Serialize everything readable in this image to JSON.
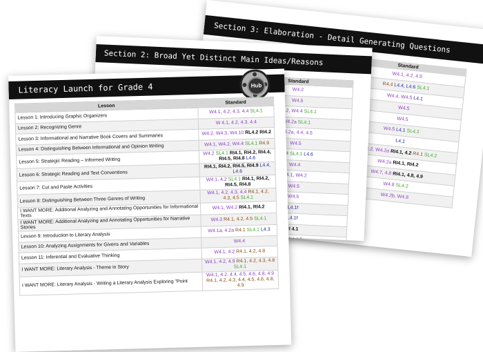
{
  "section3": {
    "title": "Section 3: Elaboration - Detail Generating Questions",
    "header": "Standard",
    "rows": [
      [
        {
          "t": "W4.1, 4.2, 4.5",
          "c": "purple"
        }
      ],
      [
        {
          "t": "R4.4",
          "c": "brown"
        },
        {
          "t": "L4.4, L4.6",
          "c": "navy"
        },
        {
          "t": "SL4.1",
          "c": "green"
        }
      ],
      [
        {
          "t": "W4.4, W4.5",
          "c": "purple"
        },
        {
          "t": "L4.1",
          "c": "navy"
        }
      ],
      [
        {
          "t": "W4.5",
          "c": "purple"
        }
      ],
      [
        {
          "t": "W4.5",
          "c": "purple"
        }
      ],
      [
        {
          "t": "W4.5",
          "c": "purple"
        },
        {
          "t": "L4.1",
          "c": "navy"
        },
        {
          "t": "SL4.1",
          "c": "green"
        }
      ],
      [
        {
          "t": "L4.1",
          "c": "navy"
        }
      ],
      [
        {
          "t": "W4.2, W4.2a",
          "c": "purple"
        },
        {
          "t": "RI4.1, 4.2",
          "c": "black"
        },
        {
          "t": "R4.1",
          "c": "brown"
        },
        {
          "t": "SL4.2",
          "c": "green"
        }
      ],
      [
        {
          "t": "W4.2a",
          "c": "purple"
        },
        {
          "t": "RI4.1, RI4.2",
          "c": "black"
        }
      ],
      [
        {
          "t": "W4.7, 4.8",
          "c": "purple"
        },
        {
          "t": "RI4.1, 4.8, 4.9",
          "c": "black"
        }
      ],
      [
        {
          "t": "W4.8",
          "c": "purple"
        },
        {
          "t": "SL4.2",
          "c": "green"
        }
      ],
      [
        {
          "t": "W4.2b, W4.8",
          "c": "purple"
        }
      ]
    ],
    "side_fragment": "ks"
  },
  "section2": {
    "title": "Section 2: Broad Yet Distinct Main Ideas/Reasons",
    "header": "Standard",
    "rows": [
      [
        {
          "t": "W4.2",
          "c": "purple"
        }
      ],
      [
        {
          "t": "W4.5",
          "c": "purple"
        }
      ],
      [
        {
          "t": "W4.2, W4.4",
          "c": "purple"
        },
        {
          "t": "SL4.1",
          "c": "green"
        }
      ],
      [
        {
          "t": "W4.2a",
          "c": "purple"
        },
        {
          "t": "SL4.1",
          "c": "green"
        }
      ],
      [
        {
          "t": "W4.2a, 4.4, 4.5",
          "c": "purple"
        }
      ],
      [
        {
          "t": "W4.5",
          "c": "purple"
        }
      ],
      [
        {
          "t": "W4.4",
          "c": "purple"
        },
        {
          "t": "SL4.1",
          "c": "green"
        },
        {
          "t": "L4.6",
          "c": "navy"
        }
      ],
      [
        {
          "t": "W4.4",
          "c": "purple"
        }
      ],
      [
        {
          "t": "W4.1, W4.2",
          "c": "purple"
        }
      ],
      [
        {
          "t": "W4.5",
          "c": "purple"
        }
      ],
      [
        {
          "t": "W4.5",
          "c": "purple"
        }
      ],
      [
        {
          "t": "L4.1f",
          "c": "navy"
        }
      ],
      [
        {
          "t": "L4.1f",
          "c": "navy"
        }
      ],
      [
        {
          "t": "RI 4.1",
          "c": "black"
        }
      ],
      [
        {
          "t": "L4.4, L4.5",
          "c": "navy"
        }
      ],
      [
        {
          "t": "W4.1, W4.2, W4.8, W4.9",
          "c": "purple"
        }
      ],
      [
        {
          "t": "W4.2, W4.4, W4.9",
          "c": "purple"
        },
        {
          "t": "R4.9",
          "c": "brown"
        }
      ]
    ]
  },
  "section1": {
    "title": "Literacy Launch for Grade 4",
    "logo_text": "Hub",
    "col_lesson": "Lesson",
    "col_standard": "Standard",
    "rows": [
      {
        "lesson": "Lesson 1: Introducing Graphic Organizers",
        "std": [
          {
            "t": "W4.1, 4.2, 4.3, 4.4",
            "c": "purple"
          },
          {
            "t": "SL4.1",
            "c": "green"
          }
        ]
      },
      {
        "lesson": "Lesson 2: Recognizing Genre",
        "std": [
          {
            "t": "W 4.1, 4.2, 4.3, 4.4",
            "c": "purple"
          }
        ]
      },
      {
        "lesson": "Lesson 3: Informational and Narrative Book Covers and Summaries",
        "std": [
          {
            "t": "W4.2, W4.3, W4.10",
            "c": "purple"
          },
          {
            "t": "RL4.2",
            "c": "black"
          },
          {
            "t": "RI4.2",
            "c": "black"
          }
        ]
      },
      {
        "lesson": "Lesson 4: Distinguishing Between Informational and Opinion Writing",
        "std": [
          {
            "t": "W4.1, W4.2, W4.4",
            "c": "purple"
          },
          {
            "t": "SL4.1",
            "c": "green"
          },
          {
            "t": "R4.9",
            "c": "brown"
          }
        ]
      },
      {
        "lesson": "Lesson 5: Strategic Reading – Informed Writing",
        "std": [
          {
            "t": "W4.2",
            "c": "purple"
          },
          {
            "t": "SL4.1",
            "c": "green"
          },
          {
            "t": "RI4.1, RI4.2, RI4.4, RI4.5, RI4.8",
            "c": "black"
          },
          {
            "t": "L4.6",
            "c": "navy"
          }
        ]
      },
      {
        "lesson": "Lesson 6: Strategic Reading and Text Conventions",
        "std": [
          {
            "t": "RI4.1, RI4.2, RI4.5, RI4.9",
            "c": "black"
          },
          {
            "t": "L4.4, L4.6",
            "c": "navy"
          }
        ]
      },
      {
        "lesson": "Lesson 7: Cut and Paste Activities",
        "std": [
          {
            "t": "W4.1, 4.2",
            "c": "purple"
          },
          {
            "t": "SL4.1",
            "c": "green"
          },
          {
            "t": "RI4.1, RI4.2, RI4.5, RI4.8",
            "c": "black"
          }
        ]
      },
      {
        "lesson": "Lesson 8: Distinguishing Between Three Genres of Writing",
        "std": [
          {
            "t": "W4.1, 4.2, 4.3, 4.4",
            "c": "purple"
          },
          {
            "t": "R4.1, 4.2, 4.3, 4.5",
            "c": "brown"
          },
          {
            "t": "SL4.1",
            "c": "green"
          }
        ]
      },
      {
        "lesson": "I WANT MORE: Additional Analyzing and Annotating Opportunities for Informational Texts",
        "std": [
          {
            "t": "W4.1, W4.2",
            "c": "purple"
          },
          {
            "t": "RI4.1, RI4.2",
            "c": "black"
          }
        ]
      },
      {
        "lesson": "I WANT MORE: Additional Analyzing and Annotating Opportunities for Narrative Stories",
        "std": [
          {
            "t": "W4.3",
            "c": "purple"
          },
          {
            "t": "R4.1, 4.2, 4.5",
            "c": "brown"
          },
          {
            "t": "SL4.1",
            "c": "green"
          }
        ]
      },
      {
        "lesson": "Lesson 9: Introduction to Literary Analysis",
        "std": [
          {
            "t": "W4.1a, 4.2a",
            "c": "purple"
          },
          {
            "t": "R4.1",
            "c": "brown"
          },
          {
            "t": "SL4.1",
            "c": "green"
          },
          {
            "t": "L4.3",
            "c": "navy"
          }
        ]
      },
      {
        "lesson": "Lesson 10: Analyzing Assignments for Givens and Variables",
        "std": [
          {
            "t": "W4.4",
            "c": "purple"
          }
        ]
      },
      {
        "lesson": "Lesson 11: Inferential and Evaluative Thinking",
        "std": [
          {
            "t": "W4.1, 4.2",
            "c": "purple"
          },
          {
            "t": "R4.1, 4.2, 4.8",
            "c": "brown"
          }
        ]
      },
      {
        "lesson": "I WANT MORE: Literary Analysis - Theme in Story",
        "std": [
          {
            "t": "W4.1, 4.2, 4.9",
            "c": "purple"
          },
          {
            "t": "R4.1, 4.2, 4.3, 4.8",
            "c": "brown"
          },
          {
            "t": "SL4.1",
            "c": "green"
          }
        ]
      },
      {
        "lesson": "I WANT MORE: Literary Analysis - Writing a Literary Analysis Exploring \"Point",
        "std": [
          {
            "t": "W4.1, 4.2, 4.4, 4.5, 4.6, 4.8, 4.9",
            "c": "purple"
          },
          {
            "t": "R4.1, 4.2, 4.3, 4.4, 4.5, 4.6, 4.8, 4.9",
            "c": "brown"
          }
        ]
      }
    ]
  },
  "colors": {
    "purple": "#8a3fc2",
    "green": "#3fa52b",
    "black": "#111111",
    "brown": "#8a4a12",
    "navy": "#1f2a99"
  }
}
